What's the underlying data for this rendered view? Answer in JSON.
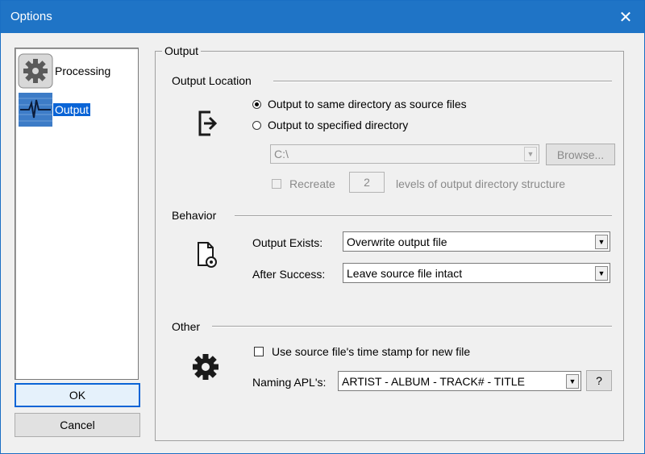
{
  "window": {
    "title": "Options",
    "close_glyph": "✕"
  },
  "sidebar": {
    "items": [
      {
        "label": "Processing",
        "icon": "gear-icon",
        "selected": false
      },
      {
        "label": "Output",
        "icon": "waveform-icon",
        "selected": true
      }
    ]
  },
  "buttons": {
    "ok": "OK",
    "cancel": "Cancel",
    "browse": "Browse...",
    "help": "?"
  },
  "output_group": {
    "caption": "Output",
    "location": {
      "heading": "Output Location",
      "radio_same": "Output to same directory as source files",
      "radio_specified": "Output to specified directory",
      "selected": "same",
      "directory_value": "C:\\",
      "recreate_label": "Recreate",
      "recreate_levels": "2",
      "recreate_suffix": "levels of output directory structure"
    },
    "behavior": {
      "heading": "Behavior",
      "output_exists_label": "Output Exists:",
      "output_exists_value": "Overwrite output file",
      "after_success_label": "After Success:",
      "after_success_value": "Leave source file intact"
    },
    "other": {
      "heading": "Other",
      "timestamp_label": "Use source file's time stamp for new file",
      "timestamp_checked": false,
      "naming_label": "Naming APL's:",
      "naming_value": "ARTIST - ALBUM - TRACK# - TITLE"
    }
  },
  "colors": {
    "titlebar": "#1f74c6",
    "selection": "#0a64d6"
  }
}
